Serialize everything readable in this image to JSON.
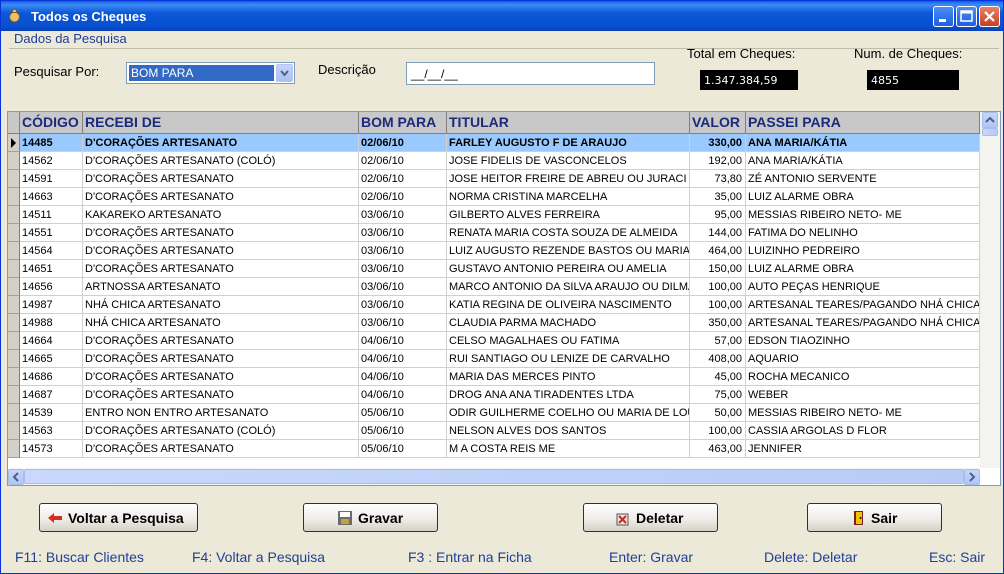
{
  "window": {
    "title": "Todos os Cheques"
  },
  "search": {
    "group_label": "Dados da Pesquisa",
    "search_by_label": "Pesquisar Por:",
    "search_by_value": "BOM PARA",
    "description_label": "Descrição",
    "description_value": "__/__/__",
    "total_label": "Total em Cheques:",
    "total_value": "1.347.384,59",
    "count_label": "Num. de Cheques:",
    "count_value": "4855"
  },
  "grid": {
    "columns": [
      "CÓDIGO",
      "RECEBI DE",
      "BOM PARA",
      "TITULAR",
      "VALOR",
      "PASSEI PARA"
    ],
    "rows": [
      [
        "14485",
        "D'CORAÇÕES ARTESANATO",
        "02/06/10",
        "FARLEY AUGUSTO F DE ARAUJO",
        "330,00",
        "ANA MARIA/KÁTIA"
      ],
      [
        "14562",
        "D'CORAÇÕES ARTESANATO (COLÓ)",
        "02/06/10",
        "JOSE FIDELIS DE VASCONCELOS",
        "192,00",
        "ANA MARIA/KÁTIA"
      ],
      [
        "14591",
        "D'CORAÇÕES ARTESANATO",
        "02/06/10",
        "JOSE HEITOR FREIRE DE ABREU OU JURACI",
        "73,80",
        "ZÉ ANTONIO SERVENTE"
      ],
      [
        "14663",
        "D'CORAÇÕES ARTESANATO",
        "02/06/10",
        "NORMA CRISTINA MARCELHA",
        "35,00",
        "LUIZ ALARME OBRA"
      ],
      [
        "14511",
        "KAKAREKO ARTESANATO",
        "03/06/10",
        "GILBERTO ALVES FERREIRA",
        "95,00",
        "MESSIAS RIBEIRO NETO- ME"
      ],
      [
        "14551",
        "D'CORAÇÕES ARTESANATO",
        "03/06/10",
        "RENATA MARIA COSTA SOUZA DE ALMEIDA",
        "144,00",
        "FATIMA DO NELINHO"
      ],
      [
        "14564",
        "D'CORAÇÕES ARTESANATO",
        "03/06/10",
        "LUIZ AUGUSTO REZENDE BASTOS OU MARIA I",
        "464,00",
        "LUIZINHO PEDREIRO"
      ],
      [
        "14651",
        "D'CORAÇÕES ARTESANATO",
        "03/06/10",
        "GUSTAVO ANTONIO PEREIRA OU AMELIA",
        "150,00",
        "LUIZ ALARME OBRA"
      ],
      [
        "14656",
        "ARTNOSSA ARTESANATO",
        "03/06/10",
        "MARCO ANTONIO DA SILVA ARAUJO OU DILMA",
        "100,00",
        "AUTO PEÇAS HENRIQUE"
      ],
      [
        "14987",
        "NHÁ CHICA ARTESANATO",
        "03/06/10",
        "KATIA REGINA DE OLIVEIRA NASCIMENTO",
        "100,00",
        "ARTESANAL TEARES/PAGANDO NHÁ CHICA"
      ],
      [
        "14988",
        "NHÁ CHICA ARTESANATO",
        "03/06/10",
        "CLAUDIA PARMA MACHADO",
        "350,00",
        "ARTESANAL TEARES/PAGANDO NHÁ CHICA"
      ],
      [
        "14664",
        "D'CORAÇÕES ARTESANATO",
        "04/06/10",
        "CELSO MAGALHAES OU FATIMA",
        "57,00",
        "EDSON TIAOZINHO"
      ],
      [
        "14665",
        "D'CORAÇÕES ARTESANATO",
        "04/06/10",
        "RUI SANTIAGO OU LENIZE DE CARVALHO",
        "408,00",
        "AQUARIO"
      ],
      [
        "14686",
        "D'CORAÇÕES ARTESANATO",
        "04/06/10",
        "MARIA DAS MERCES PINTO",
        "45,00",
        "ROCHA MECANICO"
      ],
      [
        "14687",
        "D'CORAÇÕES ARTESANATO",
        "04/06/10",
        "DROG ANA ANA TIRADENTES LTDA",
        "75,00",
        "WEBER"
      ],
      [
        "14539",
        "ENTRO NON ENTRO ARTESANATO",
        "05/06/10",
        "ODIR GUILHERME COELHO OU MARIA DE LOU",
        "50,00",
        "MESSIAS RIBEIRO NETO- ME"
      ],
      [
        "14563",
        "D'CORAÇÕES ARTESANATO (COLÓ)",
        "05/06/10",
        "NELSON ALVES DOS SANTOS",
        "100,00",
        "CASSIA ARGOLAS D FLOR"
      ],
      [
        "14573",
        "D'CORAÇÕES ARTESANATO",
        "05/06/10",
        "M A COSTA REIS ME",
        "463,00",
        "JENNIFER"
      ]
    ]
  },
  "buttons": {
    "back": "Voltar a Pesquisa",
    "save": "Gravar",
    "delete": "Deletar",
    "exit": "Sair"
  },
  "shortcuts": [
    "F11: Buscar Clientes",
    "F4: Voltar a Pesquisa",
    "F3 : Entrar na Ficha",
    "Enter: Gravar",
    "Delete: Deletar",
    "Esc: Sair"
  ],
  "colors": {
    "title_bar": "#0a5fe0",
    "selected_row": "#99c9ff",
    "label_blue": "#1f3f98"
  }
}
